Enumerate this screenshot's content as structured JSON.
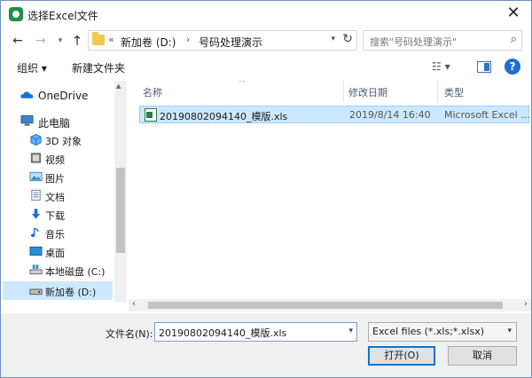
{
  "window": {
    "title": "选择Excel文件",
    "close_glyph": "✕"
  },
  "nav": {
    "back_glyph": "←",
    "forward_glyph": "→",
    "recent_glyph": "▾",
    "up_glyph": "↑"
  },
  "address": {
    "chevron_overflow": "«",
    "segments": [
      "新加卷 (D:)",
      "号码处理演示"
    ],
    "separator": "›",
    "dropdown_glyph": "▾",
    "refresh_glyph": "↻"
  },
  "search": {
    "placeholder": "搜索\"号码处理演示\"",
    "icon_glyph": "⌕"
  },
  "toolbar": {
    "organize_label": "组织 ▾",
    "new_folder_label": "新建文件夹",
    "view_label": "☷ ▾",
    "help_label": "?"
  },
  "sidebar": {
    "items": [
      {
        "label": "OneDrive",
        "icon": "onedrive-icon",
        "color": "#1b73d6"
      },
      {
        "label": "此电脑",
        "icon": "computer-icon",
        "color": "#3c86c9"
      },
      {
        "label": "3D 对象",
        "icon": "cube-3d-icon",
        "color": "#2b8fd6"
      },
      {
        "label": "视频",
        "icon": "video-icon",
        "color": "#444444"
      },
      {
        "label": "图片",
        "icon": "picture-icon",
        "color": "#3c86c9"
      },
      {
        "label": "文档",
        "icon": "document-icon",
        "color": "#5a7fa8"
      },
      {
        "label": "下载",
        "icon": "download-icon",
        "color": "#1b73d6"
      },
      {
        "label": "音乐",
        "icon": "music-icon",
        "color": "#1b73d6"
      },
      {
        "label": "桌面",
        "icon": "desktop-icon",
        "color": "#1b73d6"
      },
      {
        "label": "本地磁盘 (C:)",
        "icon": "drive-icon",
        "color": "#666666"
      },
      {
        "label": "新加卷 (D:)",
        "icon": "drive-icon",
        "color": "#555555"
      }
    ]
  },
  "filelist": {
    "columns": [
      "名称",
      "修改日期",
      "类型"
    ],
    "sort_glyph": "^",
    "rows": [
      {
        "name": "20190802094140_模版.xls",
        "date": "2019/8/14 16:40",
        "type": "Microsoft Excel ..."
      }
    ]
  },
  "bottom": {
    "filename_label": "文件名(N):",
    "filename_value": "20190802094140_模版.xls",
    "filter_value": "Excel files (*.xls;*.xlsx)",
    "dropdown_glyph": "▾",
    "open_label": "打开(O)",
    "cancel_label": "取消"
  },
  "colors": {
    "selection": "#cce8ff",
    "accent": "#0078d7",
    "excel_green": "#2a7a3b"
  }
}
